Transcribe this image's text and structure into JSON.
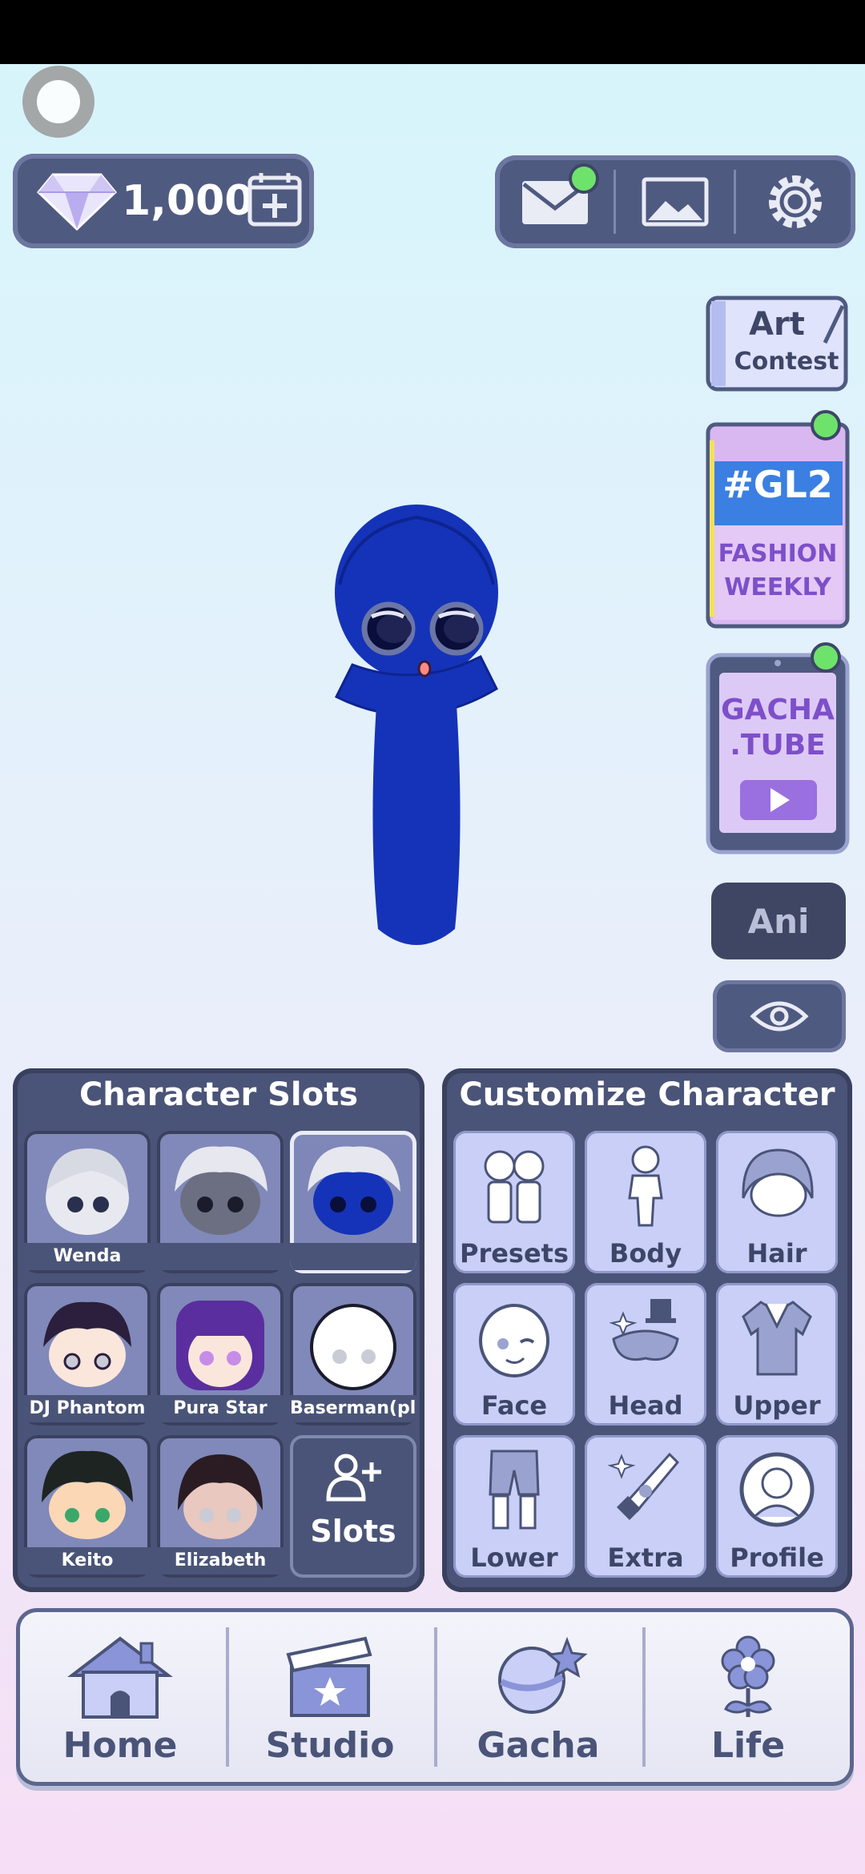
{
  "currency": {
    "gems": "1,000"
  },
  "side": {
    "art_contest": {
      "line1": "Art",
      "line2": "Contest"
    },
    "fashion": {
      "tag": "#GL2",
      "line1": "FASHION",
      "line2": "WEEKLY"
    },
    "gachatube": {
      "line1": "GACHA",
      "line2": ".TUBE"
    },
    "ani_label": "Ani"
  },
  "slots": {
    "title": "Character Slots",
    "items": [
      {
        "label": "Wenda"
      },
      {
        "label": ""
      },
      {
        "label": ""
      },
      {
        "label": "DJ Phantom"
      },
      {
        "label": "Pura Star"
      },
      {
        "label": "Baserman(plu"
      },
      {
        "label": "Keito"
      },
      {
        "label": "Elizabeth"
      }
    ],
    "add_label": "Slots"
  },
  "customize": {
    "title": "Customize Character",
    "items": [
      {
        "label": "Presets",
        "icon": "presets-icon"
      },
      {
        "label": "Body",
        "icon": "body-icon"
      },
      {
        "label": "Hair",
        "icon": "hair-icon"
      },
      {
        "label": "Face",
        "icon": "face-icon"
      },
      {
        "label": "Head",
        "icon": "head-icon"
      },
      {
        "label": "Upper",
        "icon": "upper-icon"
      },
      {
        "label": "Lower",
        "icon": "lower-icon"
      },
      {
        "label": "Extra",
        "icon": "extra-icon"
      },
      {
        "label": "Profile",
        "icon": "profile-icon"
      }
    ]
  },
  "nav": [
    {
      "label": "Home",
      "icon": "home-icon"
    },
    {
      "label": "Studio",
      "icon": "clapperboard-icon"
    },
    {
      "label": "Gacha",
      "icon": "gacha-planet-icon"
    },
    {
      "label": "Life",
      "icon": "flower-icon"
    }
  ],
  "colors": {
    "panel": "#4a5478",
    "notification": "#6ee36c",
    "character": "#1533b8"
  }
}
